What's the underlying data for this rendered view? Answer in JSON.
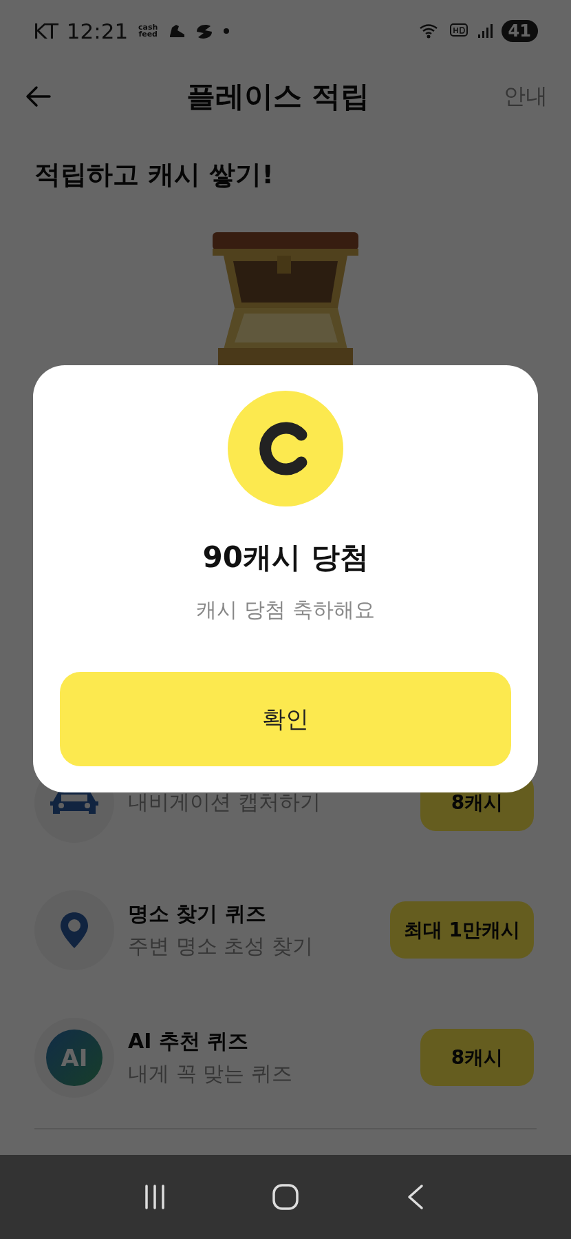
{
  "status_bar": {
    "carrier": "KT",
    "time": "12:21",
    "app_badge": "cash feed",
    "battery": "41"
  },
  "header": {
    "title": "플레이스 적립",
    "action": "안내"
  },
  "heading": "적립하고 캐시 쌓기!",
  "missions": [
    {
      "kind": "car",
      "subtitle": "내비게이션 캡처하기",
      "reward": "8캐시"
    },
    {
      "kind": "pin",
      "title": "명소 찾기 퀴즈",
      "subtitle": "주변 명소 초성 찾기",
      "reward": "최대 1만캐시"
    },
    {
      "kind": "ai",
      "icon_text": "AI",
      "title": "AI 추천 퀴즈",
      "subtitle": "내게 꼭 맞는 퀴즈",
      "reward": "8캐시"
    }
  ],
  "dialog": {
    "title": "90캐시 당첨",
    "message": "캐시 당첨 축하해요",
    "button": "확인"
  }
}
